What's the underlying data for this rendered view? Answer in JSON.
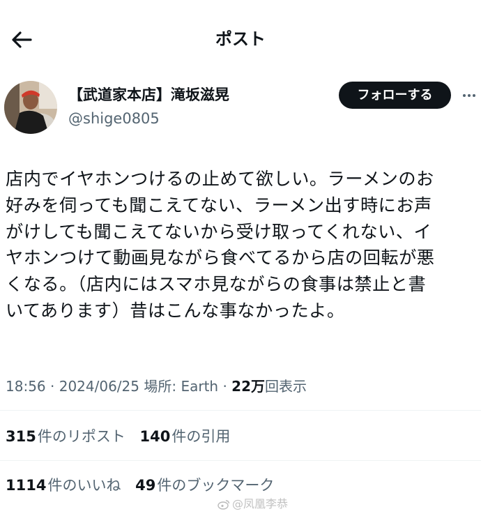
{
  "header": {
    "title": "ポスト"
  },
  "author": {
    "name": "【武道家本店】滝坂滋晃",
    "handle": "@shige0805",
    "follow_label": "フォローする"
  },
  "post": {
    "text_lines": [
      "店内でイヤホンつけるの止めて欲しい。ラーメンのお",
      "好みを伺っても聞こえてない、ラーメン出す時にお声",
      "がけしても聞こえてないから受け取ってくれない、イ",
      "ヤホンつけて動画見ながら食べてるから店の回転が悪",
      "くなる。（店内にはスマホ見ながらの食事は禁止と書",
      "いてあります）昔はこんな事なかったよ。"
    ]
  },
  "meta": {
    "time": "18:56",
    "separator": "·",
    "date": "2024/06/25",
    "location": "場所: Earth",
    "views_count": "22万",
    "views_label": "回表示"
  },
  "stats": {
    "reposts": {
      "count": "315",
      "label": "件のリポスト"
    },
    "quotes": {
      "count": "140",
      "label": "件の引用"
    },
    "likes": {
      "count": "1114",
      "label": "件のいいね"
    },
    "bookmarks": {
      "count": "49",
      "label": "件のブックマーク"
    }
  },
  "watermark": {
    "text": "@凤凰李恭"
  },
  "colors": {
    "text": "#0f1419",
    "secondary": "#536471",
    "divider": "#eff3f4",
    "follow_bg": "#0f1419"
  },
  "icons": {
    "back": "back-arrow-icon",
    "more": "more-horizontal-icon",
    "watermark": "weibo-icon"
  }
}
